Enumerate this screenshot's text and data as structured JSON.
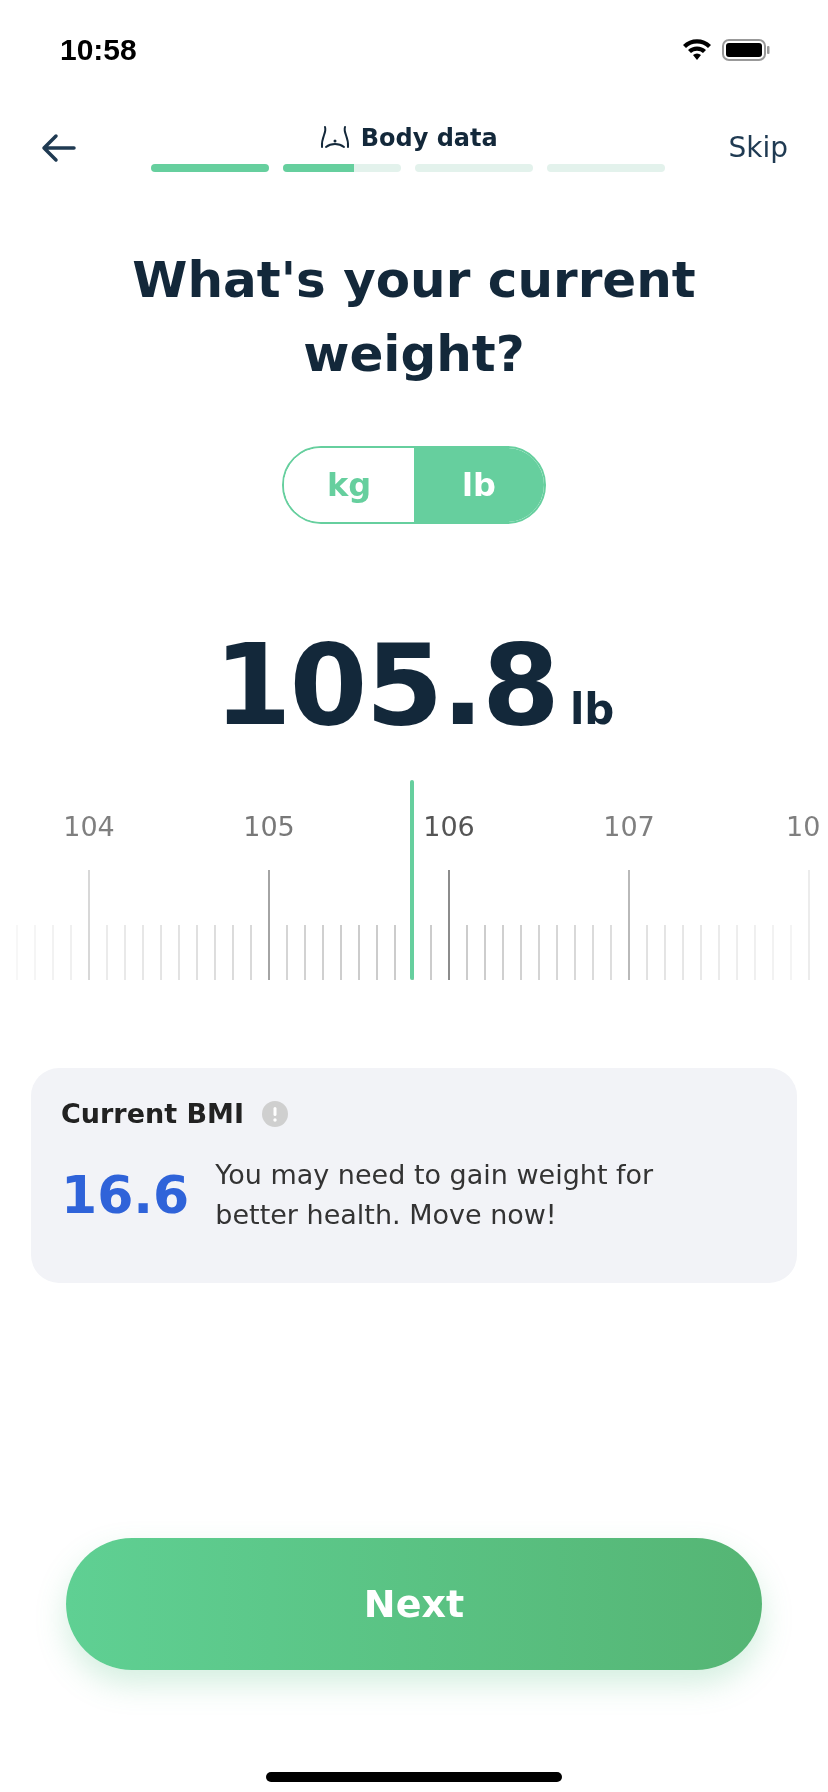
{
  "status_bar": {
    "time": "10:58"
  },
  "header": {
    "title": "Body data",
    "skip": "Skip",
    "progress": [
      {
        "level": 1
      },
      {
        "level": 0.6
      },
      {
        "level": 0
      },
      {
        "level": 0
      }
    ]
  },
  "question": "What's your current weight?",
  "units": [
    {
      "label": "kg",
      "selected": false
    },
    {
      "label": "lb",
      "selected": true
    }
  ],
  "weight": {
    "value": "105.8",
    "unit": "lb"
  },
  "ruler": {
    "labels": [
      "104",
      "105",
      "106",
      "107",
      "10"
    ]
  },
  "bmi": {
    "title": "Current BMI",
    "value": "16.6",
    "message": "You may need to gain weight for better health. Move now!"
  },
  "next_button": "Next"
}
